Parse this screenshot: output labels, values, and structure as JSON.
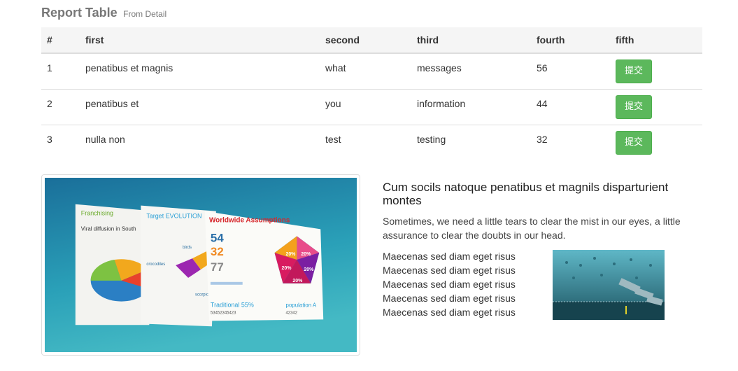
{
  "header": {
    "title": "Report Table",
    "subtitle": "From Detail"
  },
  "table": {
    "columns": [
      "#",
      "first",
      "second",
      "third",
      "fourth",
      "fifth"
    ],
    "rows": [
      {
        "num": "1",
        "first": "penatibus et magnis",
        "second": "what",
        "third": "messages",
        "fourth": "56",
        "action": "提交"
      },
      {
        "num": "2",
        "first": "penatibus et",
        "second": "you",
        "third": "information",
        "fourth": "44",
        "action": "提交"
      },
      {
        "num": "3",
        "first": "nulla non",
        "second": "test",
        "third": "testing",
        "fourth": "32",
        "action": "提交"
      }
    ]
  },
  "infographic": {
    "title": "Worldwide Assumptions",
    "panel1_title": "Franchising",
    "panel1_sub": "Viral diffusion in South",
    "panel2_title": "Target EVOLUTION",
    "panel2_labels": [
      "birds",
      "crocodiles",
      "scorpions"
    ],
    "numbers": [
      "54",
      "32",
      "77"
    ],
    "traditional": "Traditional 55%",
    "traditional_num": "53452345423",
    "population": "population A",
    "population_num": "42342",
    "pentagon_pcts": [
      "20%",
      "20%",
      "20%",
      "20%",
      "20%"
    ]
  },
  "caption": {
    "heading": "Cum socils natoque penatibus et magnils disparturient montes",
    "paragraph": "Sometimes, we need a little tears to clear the mist in our eyes, a little assurance to clear the doubts in our head.",
    "list": [
      "Maecenas sed diam eget risus",
      "Maecenas sed diam eget risus",
      "Maecenas sed diam eget risus",
      "Maecenas sed diam eget risus",
      "Maecenas sed diam eget risus"
    ]
  }
}
